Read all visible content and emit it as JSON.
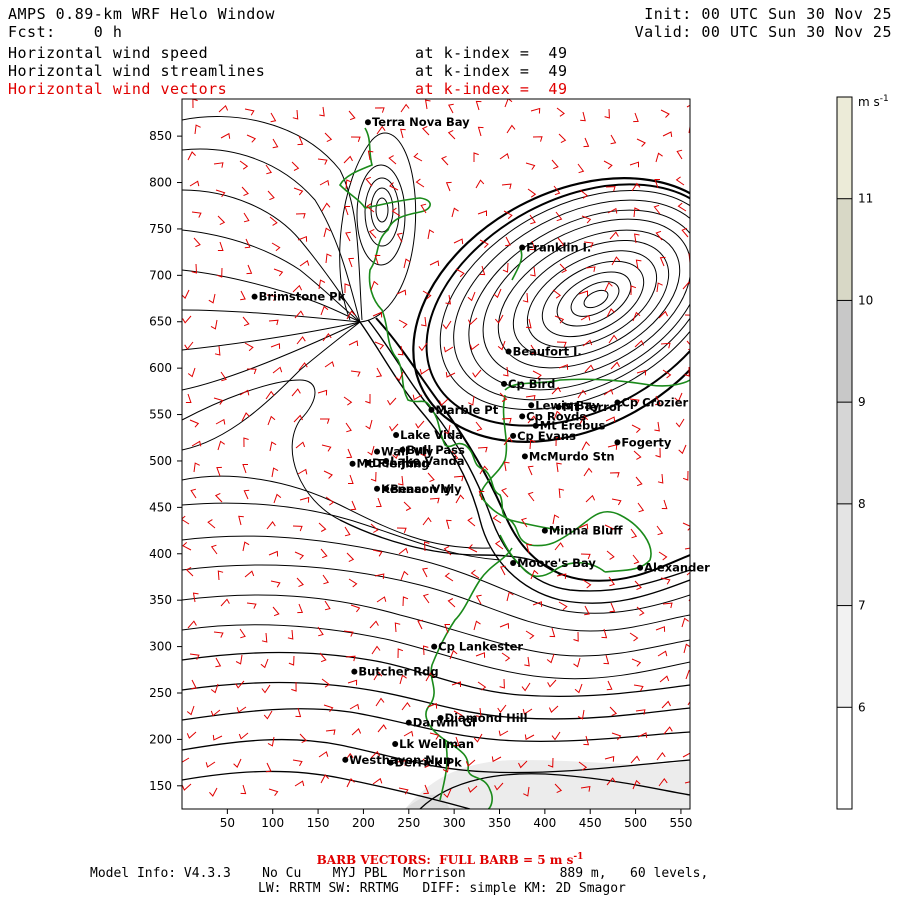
{
  "header": {
    "title": "AMPS 0.89-km WRF Helo Window",
    "fcst_label": "Fcst:",
    "fcst_value": "0 h",
    "init": "Init: 00 UTC Sun 30 Nov 25",
    "valid": "Valid: 00 UTC Sun 30 Nov 25",
    "fields": [
      {
        "name": "Horizontal wind speed",
        "level": "at k-index =  49",
        "color": "#000000"
      },
      {
        "name": "Horizontal wind streamlines",
        "level": "at k-index =  49",
        "color": "#000000"
      },
      {
        "name": "Horizontal wind vectors",
        "level": "at k-index =  49",
        "color": "#e00000"
      }
    ]
  },
  "map": {
    "x_ticks": [
      50,
      100,
      150,
      200,
      250,
      300,
      350,
      400,
      450,
      500,
      550
    ],
    "y_ticks": [
      150,
      200,
      250,
      300,
      350,
      400,
      450,
      500,
      550,
      600,
      650,
      700,
      750,
      800,
      850
    ],
    "xlim": [
      0,
      560
    ],
    "ylim": [
      125,
      890
    ],
    "coastline_color": "#1a8a1a",
    "vector_color": "#e00000",
    "streamline_color": "#000000",
    "places": [
      {
        "name": "Terra Nova Bay",
        "x": 205,
        "y": 865
      },
      {
        "name": "Brimstone Pk",
        "x": 80,
        "y": 677
      },
      {
        "name": "Franklin I.",
        "x": 375,
        "y": 730
      },
      {
        "name": "Beaufort I.",
        "x": 360,
        "y": 618
      },
      {
        "name": "Cp Bird",
        "x": 355,
        "y": 583
      },
      {
        "name": "Lewis Bay",
        "x": 385,
        "y": 560
      },
      {
        "name": "Cp Crozier",
        "x": 480,
        "y": 563
      },
      {
        "name": "Mt Terror",
        "x": 415,
        "y": 558
      },
      {
        "name": "Marble Pt",
        "x": 275,
        "y": 555
      },
      {
        "name": "Cp Royds",
        "x": 375,
        "y": 548
      },
      {
        "name": "Mt Erebus",
        "x": 390,
        "y": 538
      },
      {
        "name": "Lake Vida",
        "x": 236,
        "y": 528
      },
      {
        "name": "Cp Evans",
        "x": 365,
        "y": 527
      },
      {
        "name": "Fogerty",
        "x": 480,
        "y": 520
      },
      {
        "name": "Wall Vly",
        "x": 215,
        "y": 510
      },
      {
        "name": "Bull Pass",
        "x": 243,
        "y": 512
      },
      {
        "name": "McMurdo Stn",
        "x": 378,
        "y": 505
      },
      {
        "name": "Don Juan",
        "x": 205,
        "y": 498
      },
      {
        "name": "Mt Fleming",
        "x": 188,
        "y": 497
      },
      {
        "name": "Lake Vanda",
        "x": 225,
        "y": 500
      },
      {
        "name": "Kennar Vly",
        "x": 215,
        "y": 470
      },
      {
        "name": "Beacon Vly",
        "x": 225,
        "y": 470
      },
      {
        "name": "Minna Bluff",
        "x": 400,
        "y": 425
      },
      {
        "name": "Moore's Bay",
        "x": 365,
        "y": 390
      },
      {
        "name": "Alexander",
        "x": 505,
        "y": 385
      },
      {
        "name": "Cp Lankester",
        "x": 278,
        "y": 300
      },
      {
        "name": "Butcher Rdg",
        "x": 190,
        "y": 273
      },
      {
        "name": "Darwin Gl",
        "x": 250,
        "y": 218
      },
      {
        "name": "Diamond Hill",
        "x": 285,
        "y": 223
      },
      {
        "name": "Lk Wellman",
        "x": 235,
        "y": 195
      },
      {
        "name": "Westhaven Nun",
        "x": 180,
        "y": 178
      },
      {
        "name": "Derrick Pk",
        "x": 230,
        "y": 175
      }
    ]
  },
  "colorbar": {
    "unit_label": "m s",
    "unit_exp": "-1",
    "ticks": [
      "6",
      "7",
      "8",
      "9",
      "10",
      "11"
    ],
    "min": 5,
    "max": 12,
    "colors": [
      "#ffffff",
      "#f2f2f2",
      "#e4e4e4",
      "#d6d6d6",
      "#c8c8c8",
      "#d8d8c6",
      "#ecebd8"
    ]
  },
  "footer": {
    "barb_note": "BARB VECTORS:  FULL BARB = 5 m s",
    "barb_exp": "-1",
    "model_info": "Model Info: V4.3.3    No Cu    MYJ PBL  Morrison            889 m,   60 levels,",
    "physics": "LW: RRTM SW: RRTMG   DIFF: simple KM: 2D Smagor"
  }
}
